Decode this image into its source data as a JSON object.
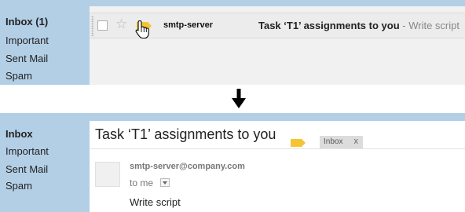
{
  "before": {
    "sidebar": {
      "items": [
        {
          "label": "Inbox (1)",
          "bold": true
        },
        {
          "label": "Important"
        },
        {
          "label": "Sent Mail"
        },
        {
          "label": "Spam"
        }
      ]
    },
    "email_row": {
      "sender": "smtp-server",
      "subject": "Task ‘T1’ assignments to you",
      "snippet": " - Write script"
    }
  },
  "after": {
    "sidebar": {
      "items": [
        {
          "label": "Inbox",
          "bold": true
        },
        {
          "label": "Important"
        },
        {
          "label": "Sent Mail"
        },
        {
          "label": "Spam"
        }
      ]
    },
    "message": {
      "subject": "Task ‘T1’ assignments to you",
      "chip_label": "Inbox",
      "chip_close": "x",
      "from": "smtp-server@company.com",
      "to": "to me",
      "body": "Write script"
    }
  },
  "colors": {
    "sidebar_bg": "#b3cfe6",
    "label_tag": "#f5c436",
    "row_bg": "#ececec"
  },
  "icons": {
    "arrow": "down-arrow-icon",
    "cursor": "hand-pointer-icon",
    "star": "star-icon",
    "tag": "label-tag-icon"
  }
}
